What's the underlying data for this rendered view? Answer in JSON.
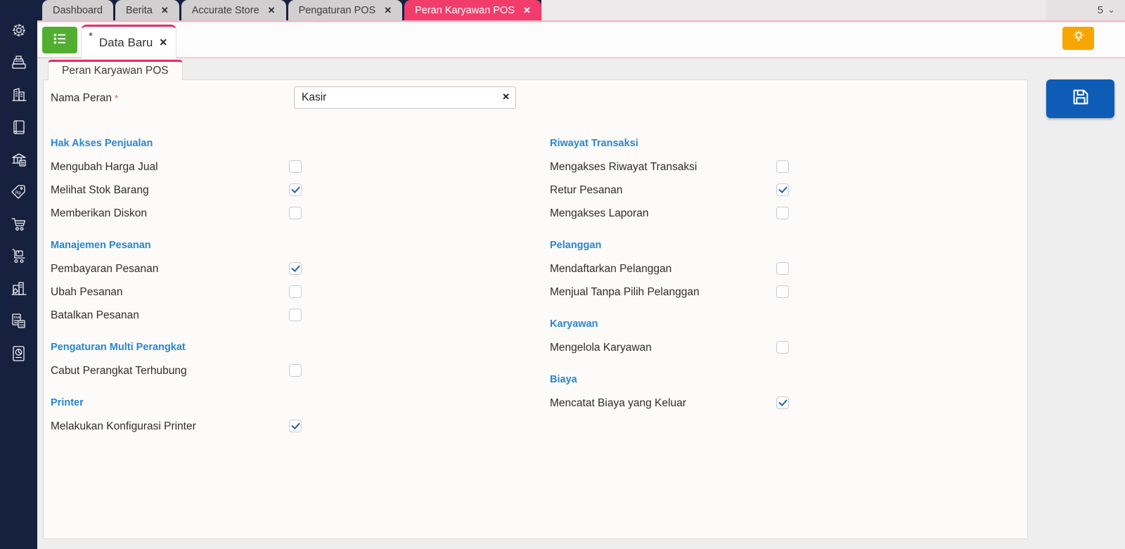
{
  "app": {
    "tab_bar": {
      "tabs": [
        {
          "label": "Dashboard",
          "closable": false,
          "active": false
        },
        {
          "label": "Berita",
          "closable": true,
          "active": false
        },
        {
          "label": "Accurate Store",
          "closable": true,
          "active": false
        },
        {
          "label": "Pengaturan POS",
          "closable": true,
          "active": false
        },
        {
          "label": "Peran Karyawan POS",
          "closable": true,
          "active": true
        }
      ],
      "close_glyph": "✕",
      "counter": "5",
      "chevron_glyph": "⌄"
    },
    "toolbar": {
      "list_button_icon": "list-icon",
      "document_tab": {
        "modified_mark": "*",
        "label": "Data Baru",
        "close_glyph": "✕"
      },
      "bulb_button_icon": "lightbulb-icon"
    },
    "sidebar_icons": [
      "settings",
      "cash-register",
      "company",
      "book",
      "bank-store",
      "price-tag-rp",
      "shopping-cart",
      "delivery-trolley",
      "manufacture",
      "tax-document",
      "report-document"
    ],
    "form": {
      "tab_label": "Peran Karyawan POS",
      "name_field": {
        "label": "Nama Peran",
        "required_mark": "*",
        "value": "Kasir",
        "clear_glyph": "✕"
      },
      "save_button_icon": "floppy-disk-icon",
      "columns": [
        {
          "sections": [
            {
              "title": "Hak Akses Penjualan",
              "items": [
                {
                  "label": "Mengubah Harga Jual",
                  "checked": false
                },
                {
                  "label": "Melihat Stok Barang",
                  "checked": true
                },
                {
                  "label": "Memberikan Diskon",
                  "checked": false
                }
              ]
            },
            {
              "title": "Manajemen Pesanan",
              "items": [
                {
                  "label": "Pembayaran Pesanan",
                  "checked": true
                },
                {
                  "label": "Ubah Pesanan",
                  "checked": false
                },
                {
                  "label": "Batalkan Pesanan",
                  "checked": false
                }
              ]
            },
            {
              "title": "Pengaturan Multi Perangkat",
              "items": [
                {
                  "label": "Cabut Perangkat Terhubung",
                  "checked": false
                }
              ]
            },
            {
              "title": "Printer",
              "items": [
                {
                  "label": "Melakukan Konfigurasi Printer",
                  "checked": true
                }
              ]
            }
          ]
        },
        {
          "sections": [
            {
              "title": "Riwayat Transaksi",
              "items": [
                {
                  "label": "Mengakses Riwayat Transaksi",
                  "checked": false
                },
                {
                  "label": "Retur Pesanan",
                  "checked": true
                },
                {
                  "label": "Mengakses Laporan",
                  "checked": false
                }
              ]
            },
            {
              "title": "Pelanggan",
              "items": [
                {
                  "label": "Mendaftarkan Pelanggan",
                  "checked": false
                },
                {
                  "label": "Menjual Tanpa Pilih Pelanggan",
                  "checked": false
                }
              ]
            },
            {
              "title": "Karyawan",
              "items": [
                {
                  "label": "Mengelola Karyawan",
                  "checked": false
                }
              ]
            },
            {
              "title": "Biaya",
              "items": [
                {
                  "label": "Mencatat Biaya yang Keluar",
                  "checked": true
                }
              ]
            }
          ]
        }
      ]
    },
    "colors": {
      "sidebar_navy": "#16213f",
      "accent_pink": "#f23c6c",
      "tab_border_pink": "#ec2a63",
      "section_blue": "#2a85cf",
      "check_blue": "#1d5fae",
      "green": "#52ae30",
      "save_blue": "#0e5cb5",
      "orange": "#f7a600"
    }
  }
}
